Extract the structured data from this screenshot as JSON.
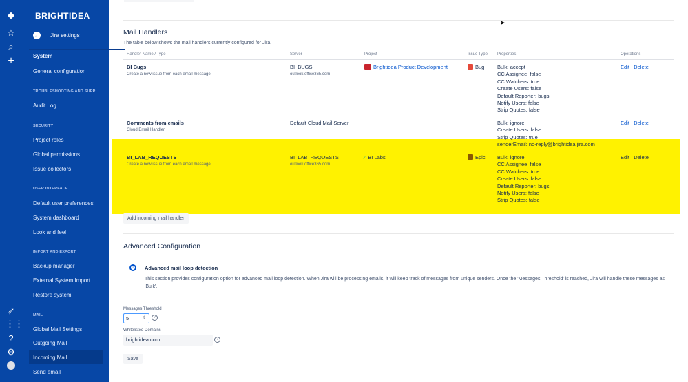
{
  "brand": "BRIGHTIDEA",
  "rail_icons": [
    "jira-logo-icon",
    "star-icon",
    "search-icon",
    "plus-icon",
    "rocket-icon",
    "apps-grid-icon",
    "help-icon",
    "gear-icon",
    "avatar"
  ],
  "sidebar": {
    "back_label": "Jira settings",
    "items": [
      {
        "type": "item",
        "label": "System"
      },
      {
        "type": "item",
        "label": "General configuration"
      },
      {
        "type": "header",
        "label": "TROUBLESHOOTING AND SUPP..."
      },
      {
        "type": "item",
        "label": "Audit Log"
      },
      {
        "type": "header",
        "label": "SECURITY"
      },
      {
        "type": "item",
        "label": "Project roles"
      },
      {
        "type": "item",
        "label": "Global permissions"
      },
      {
        "type": "item",
        "label": "Issue collectors"
      },
      {
        "type": "header",
        "label": "USER INTERFACE"
      },
      {
        "type": "item",
        "label": "Default user preferences"
      },
      {
        "type": "item",
        "label": "System dashboard"
      },
      {
        "type": "item",
        "label": "Look and feel"
      },
      {
        "type": "header",
        "label": "IMPORT AND EXPORT"
      },
      {
        "type": "item",
        "label": "Backup manager"
      },
      {
        "type": "item",
        "label": "External System Import"
      },
      {
        "type": "item",
        "label": "Restore system"
      },
      {
        "type": "header",
        "label": "MAIL"
      },
      {
        "type": "item",
        "label": "Global Mail Settings"
      },
      {
        "type": "item",
        "label": "Outgoing Mail"
      },
      {
        "type": "item",
        "label": "Incoming Mail",
        "selected": true
      },
      {
        "type": "item",
        "label": "Send email"
      }
    ]
  },
  "mail_handlers": {
    "title": "Mail Handlers",
    "description": "The table below shows the mail handlers currently configured for Jira.",
    "columns": [
      "Handler Name / Type",
      "Server",
      "Project",
      "Issue Type",
      "Properties",
      "Operations"
    ],
    "rows": [
      {
        "name": "BI Bugs",
        "type": "Create a new issue from each email message",
        "server": "BI_BUGS",
        "server_host": "outlook.office365.com",
        "project": "Brightidea Product Development",
        "issue_type": "Bug",
        "properties": [
          "Bulk: accept",
          "CC Assignee: false",
          "CC Watchers: true",
          "Create Users: false",
          "Default Reporter: bugs",
          "Notify Users: false",
          "Strip Quotes: false"
        ],
        "edit": "Edit",
        "delete": "Delete"
      },
      {
        "name": "Comments from emails",
        "type": "Cloud Email Handler",
        "server": "Default Cloud Mail Server",
        "server_host": "",
        "project": "",
        "issue_type": "",
        "properties": [
          "Bulk: ignore",
          "Create Users: false",
          "Strip Quotes: true",
          "senderEmail: no-reply@brightidea.jira.com"
        ],
        "edit": "Edit",
        "delete": "Delete"
      },
      {
        "name": "BI_LAB_REQUESTS",
        "type": "Create a new issue from each email message",
        "server": "BI_LAB_REQUESTS",
        "server_host": "outlook.office365.com",
        "project": "BI Labs",
        "issue_type": "Epic",
        "properties": [
          "Bulk: ignore",
          "CC Assignee: false",
          "CC Watchers: true",
          "Create Users: false",
          "Default Reporter: bugs",
          "Notify Users: false",
          "Strip Quotes: false"
        ],
        "edit": "Edit",
        "delete": "Delete",
        "highlighted": true
      }
    ],
    "add_button": "Add incoming mail handler",
    "highlight_color": "#fff200"
  },
  "advanced": {
    "title": "Advanced Configuration",
    "info_title": "Advanced mail loop detection",
    "info_text": "This section provides configuration option for advanced mail loop detection. When Jira will be processing emails, it will keep track of messages from unique senders. Once the 'Messages Threshold' is reached, Jira will handle these messages as 'Bulk'.",
    "threshold_label": "Messages Threshold",
    "threshold_value": "5",
    "domains_label": "Whitelisted Domains",
    "domains_value": "brightidea.com",
    "save_label": "Save"
  }
}
